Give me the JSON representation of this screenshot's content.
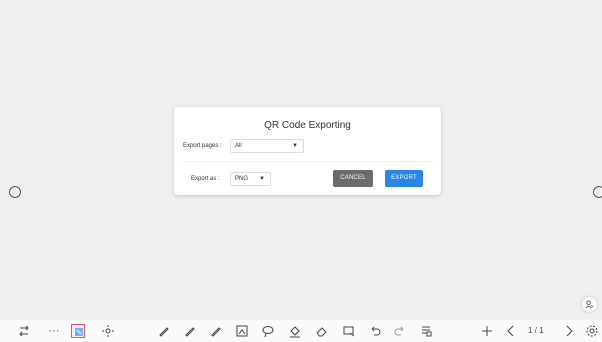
{
  "dialog": {
    "title": "QR Code Exporting",
    "export_pages_label": "Export pages :",
    "export_pages_value": "All",
    "export_as_label": "Export as :",
    "export_as_value": "PNG",
    "cancel_label": "CANCEL",
    "export_label": "EXPORT",
    "dropdown_arrow": "▼"
  },
  "toolbar": {
    "page_indicator": "1 / 1",
    "icons": [
      "switch-pen-icon",
      "more-icon",
      "select-icon",
      "move-icon",
      "pen-icon",
      "pen-icon",
      "pen-icon",
      "image-insert-icon",
      "lasso-icon",
      "fill-icon",
      "eraser-icon",
      "clear-icon",
      "undo-icon",
      "redo-icon",
      "page-list-icon",
      "add-page-icon",
      "prev-page-icon",
      "next-page-icon",
      "settings-icon"
    ]
  },
  "colors": {
    "accent": "#2a86e6",
    "cancel": "#6b6b6b",
    "background": "#efefef"
  }
}
